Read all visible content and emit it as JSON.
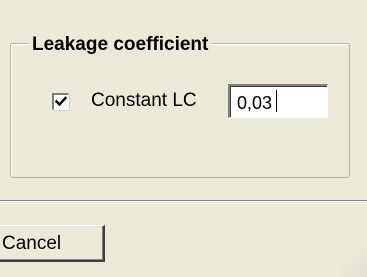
{
  "group": {
    "title": "Leakage coefficient"
  },
  "constant_lc": {
    "label": "Constant LC",
    "checked": true,
    "value": "0,03"
  },
  "footer": {
    "cancel_label": "Cancel"
  }
}
